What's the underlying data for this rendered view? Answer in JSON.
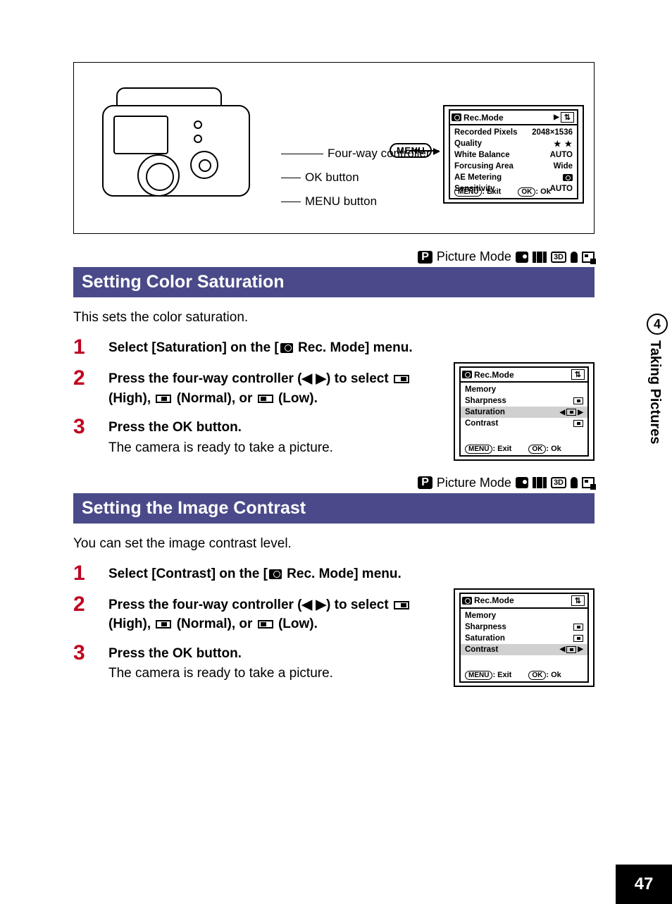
{
  "page_number": "47",
  "side_tab": {
    "number": "4",
    "label": "Taking Pictures"
  },
  "diagram": {
    "labels": {
      "four_way": "Four-way controller",
      "ok": "OK button",
      "menu": "MENU button",
      "menu_badge": "MENU"
    },
    "lcd": {
      "title": "Rec.Mode",
      "tab_icon": "⇅",
      "rows": [
        {
          "label": "Recorded Pixels",
          "value": "2048×1536"
        },
        {
          "label": "Quality",
          "value": "★ ★"
        },
        {
          "label": "White Balance",
          "value": "AUTO"
        },
        {
          "label": "Forcusing Area",
          "value": "Wide"
        },
        {
          "label": "AE Metering",
          "value": "◉"
        },
        {
          "label": "Sensitivity",
          "value": "AUTO"
        }
      ],
      "bottom": {
        "menu": "MENU",
        "exit": ": Exit",
        "ok": "OK",
        "oklab": ": Ok"
      }
    }
  },
  "mode_line": {
    "label": "Picture Mode"
  },
  "saturation": {
    "heading": "Setting Color Saturation",
    "intro": "This sets the color saturation.",
    "steps": {
      "s1": "Select [Saturation] on the [",
      "s1b": " Rec. Mode] menu.",
      "s2a": "Press the four-way controller (◀ ▶) to select ",
      "s2b": " (High), ",
      "s2c": " (Normal), or ",
      "s2d": " (Low).",
      "s3": "Press the OK button.",
      "s3sub": "The camera is ready to take a picture."
    },
    "lcd": {
      "title": "Rec.Mode",
      "rows": [
        "Memory",
        "Sharpness",
        "Saturation",
        "Contrast"
      ],
      "selected_index": 2,
      "bottom": {
        "menu": "MENU",
        "exit": ": Exit",
        "ok": "OK",
        "oklab": ": Ok"
      }
    }
  },
  "contrast": {
    "heading": "Setting the Image Contrast",
    "intro": "You can set the image contrast level.",
    "steps": {
      "s1": "Select [Contrast] on the [",
      "s1b": " Rec. Mode] menu.",
      "s2a": "Press the four-way controller (◀ ▶) to select ",
      "s2b": " (High), ",
      "s2c": " (Normal), or ",
      "s2d": " (Low).",
      "s3": "Press the OK button.",
      "s3sub": "The camera is ready to take a picture."
    },
    "lcd": {
      "title": "Rec.Mode",
      "rows": [
        "Memory",
        "Sharpness",
        "Saturation",
        "Contrast"
      ],
      "selected_index": 3,
      "bottom": {
        "menu": "MENU",
        "exit": ": Exit",
        "ok": "OK",
        "oklab": ": Ok"
      }
    }
  }
}
